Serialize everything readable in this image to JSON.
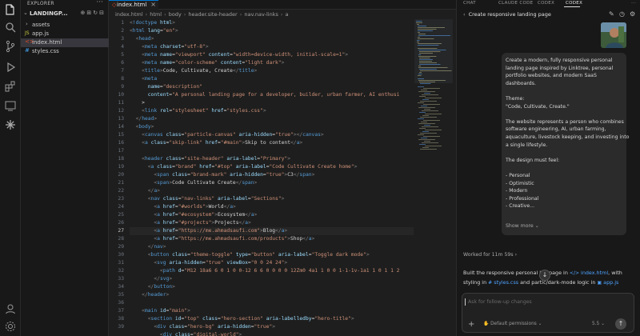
{
  "explorer": {
    "title": "EXPLORER",
    "root": "LANDINGP...",
    "files": [
      {
        "name": "assets",
        "kind": "folder"
      },
      {
        "name": "app.js",
        "kind": "js"
      },
      {
        "name": "index.html",
        "kind": "html",
        "selected": true
      },
      {
        "name": "styles.css",
        "kind": "css"
      }
    ]
  },
  "editor": {
    "tab": "index.html",
    "breadcrumb": [
      "index.html",
      "html",
      "body",
      "header.site-header",
      "nav.nav-links",
      "a"
    ],
    "current_line": 27,
    "line_numbers": [
      "1",
      "2",
      "3",
      "4",
      "5",
      "6",
      "7",
      "8",
      "9",
      "10",
      "11",
      "12",
      "13",
      "14",
      "15",
      "16",
      "17",
      "18",
      "19",
      "20",
      "21",
      "22",
      "23",
      "24",
      "25",
      "26",
      "27",
      "28",
      "29",
      "30",
      "31",
      "32",
      "33",
      "34",
      "35",
      "36",
      "37",
      "38",
      "39"
    ],
    "lines": [
      [
        "<!doctype html>"
      ],
      [
        "<html lang=\"en\">"
      ],
      [
        "  <head>"
      ],
      [
        "    <meta charset=\"utf-8\">"
      ],
      [
        "    <meta name=\"viewport\" content=\"width=device-width, initial-scale=1\">"
      ],
      [
        "    <meta name=\"color-scheme\" content=\"light dark\">"
      ],
      [
        "    <title>Code, Cultivate, Create</title>"
      ],
      [
        "    <meta"
      ],
      [
        "      name=\"description\""
      ],
      [
        "      content=\"A personal landing page for a developer, builder, urban farmer, AI enthusi"
      ],
      [
        "    >"
      ],
      [
        "    <link rel=\"stylesheet\" href=\"styles.css\">"
      ],
      [
        "  </head>"
      ],
      [
        "  <body>"
      ],
      [
        "    <canvas class=\"particle-canvas\" aria-hidden=\"true\"></canvas>"
      ],
      [
        "    <a class=\"skip-link\" href=\"#main\">Skip to content</a>"
      ],
      [
        ""
      ],
      [
        "    <header class=\"site-header\" aria-label=\"Primary\">"
      ],
      [
        "      <a class=\"brand\" href=\"#top\" aria-label=\"Code Cultivate Create home\">"
      ],
      [
        "        <span class=\"brand-mark\" aria-hidden=\"true\">C3</span>"
      ],
      [
        "        <span>Code Cultivate Create</span>"
      ],
      [
        "      </a>"
      ],
      [
        "      <nav class=\"nav-links\" aria-label=\"Sections\">"
      ],
      [
        "        <a href=\"#worlds\">World</a>"
      ],
      [
        "        <a href=\"#ecosystem\">Ecosystem</a>"
      ],
      [
        "        <a href=\"#projects\">Projects</a>"
      ],
      [
        "        <a href=\"https://me.ahmadsaufi.com\">Blog</a>"
      ],
      [
        "        <a href=\"https://me.ahmadsaufi.com/products\">Shop</a>"
      ],
      [
        "      </nav>"
      ],
      [
        "      <button class=\"theme-toggle\" type=\"button\" aria-label=\"Toggle dark mode\">"
      ],
      [
        "        <svg aria-hidden=\"true\" viewBox=\"0 0 24 24\">"
      ],
      [
        "          <path d=\"M12 18a6 6 0 1 0 0-12 6 6 0 0 0 0 12Zm0 4a1 1 0 0 1-1-1v-1a1 1 0 1 1 2"
      ],
      [
        "        </svg>"
      ],
      [
        "      </button>"
      ],
      [
        "    </header>"
      ],
      [
        ""
      ],
      [
        "    <main id=\"main\">"
      ],
      [
        "      <section id=\"top\" class=\"hero-section\" aria-labelledby=\"hero-title\">"
      ],
      [
        "        <div class=\"hero-bg\" aria-hidden=\"true\">"
      ],
      [
        "          <div class=\"digital-world\">"
      ]
    ]
  },
  "chat": {
    "tabs": [
      "CHAT",
      "CLAUDE CODE",
      "CODEX",
      "CODEX"
    ],
    "title": "Create responsive landing page",
    "prompt_lines": [
      "Create a modern, fully responsive personal",
      "landing page inspired by Linktree, personal",
      "portfolio websites, and modern SaaS",
      "dashboards.",
      "",
      "Theme:",
      "\"Code, Cultivate, Create.\"",
      "",
      "The website represents a person who combines",
      "software engineering, AI, urban farming,",
      "aquaculture, livestock keeping, and investing into",
      "a single lifestyle.",
      "",
      "The design must feel:",
      "",
      "- Personal",
      "- Optimistic",
      "- Modern",
      "- Professional",
      "- Creative..."
    ],
    "show_more": "Show more",
    "worked_for": "Worked for 11m 59s",
    "result_line1_a": "Built the responsive personal lan",
    "result_line1_b": " page in ",
    "result_file1": "index.html",
    "result_line1_c": ", with",
    "result_line2_a": "styling in ",
    "result_file2": "styles.css",
    "result_line2_b": " and partic",
    "result_line2_c": "/dark-mode logic in ",
    "result_file3": "app.js",
    "input_placeholder": "Ask for follow-up changes",
    "permissions": "Default permissions",
    "model": "5.5"
  }
}
